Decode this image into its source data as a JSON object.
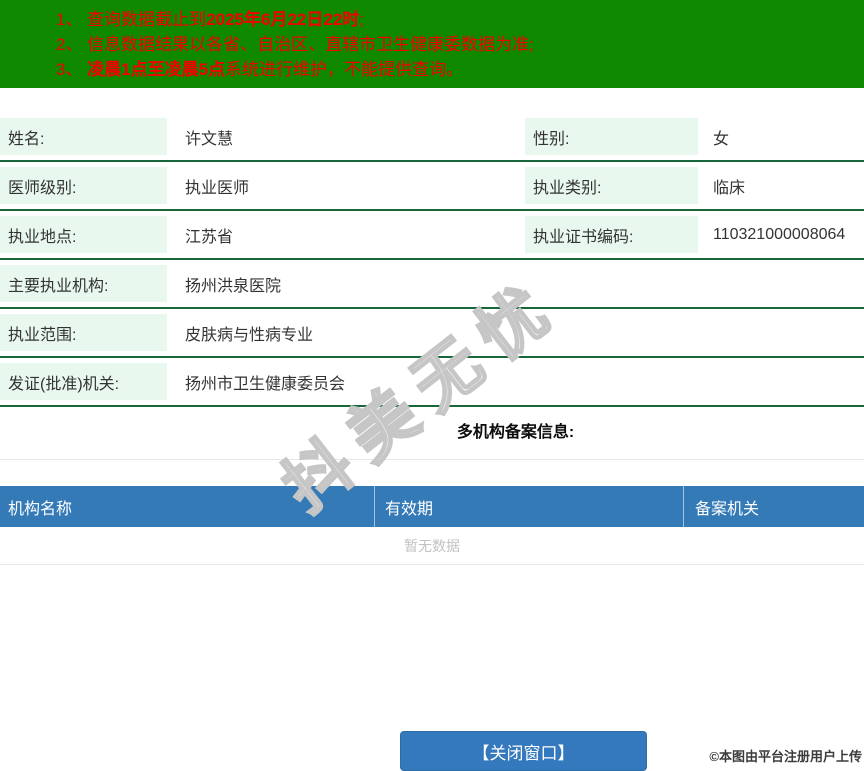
{
  "banner": {
    "bg_color": "#0e8900",
    "text_color": "#f40000",
    "lines": [
      {
        "pre": "1、 查询数据截止到",
        "bold": "2025年6月22日22时",
        "post": ";"
      },
      {
        "pre": "2、 信息数据结果以各省、自治区、直辖市卫生健康委数据为准;",
        "bold": "",
        "post": ""
      },
      {
        "pre": "3、 ",
        "bold": "凌晨1点至凌晨5点",
        "post": "系统进行维护，不能提供查询。"
      }
    ]
  },
  "info": {
    "label_bg": "#e9f8ef",
    "row_line_color": "#17673a",
    "rows": [
      {
        "label": "姓名:",
        "value": "许文慧",
        "label2": "性别:",
        "value2": "女"
      },
      {
        "label": "医师级别:",
        "value": "执业医师",
        "label2": "执业类别:",
        "value2": "临床"
      },
      {
        "label": "执业地点:",
        "value": "江苏省",
        "label2": "执业证书编码:",
        "value2": "110321000008064"
      },
      {
        "label": "主要执业机构:",
        "value": "扬州洪泉医院"
      },
      {
        "label": "执业范围:",
        "value": "皮肤病与性病专业"
      },
      {
        "label": "发证(批准)机关:",
        "value": "扬州市卫生健康委员会"
      }
    ]
  },
  "section": {
    "title": "多机构备案信息:"
  },
  "filing_table": {
    "header_bg": "#337ab7",
    "headers": [
      "机构名称",
      "有效期",
      "备案机关"
    ],
    "empty_text": "暂无数据"
  },
  "footer": {
    "close_button_label": "【关闭窗口】",
    "button_color": "#3478bd",
    "copyright": "©本图由平台注册用户上传"
  },
  "watermark": {
    "text": "抖美无忧"
  }
}
